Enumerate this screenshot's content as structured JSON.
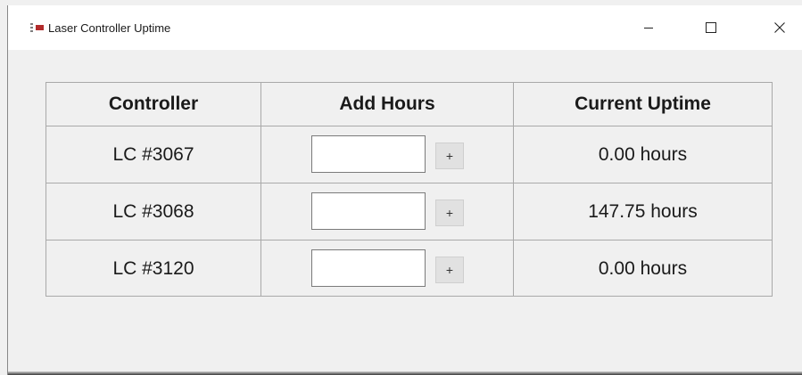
{
  "window": {
    "title": "Laser Controller Uptime",
    "buttons": {
      "minimize_icon": "minimize-icon",
      "maximize_icon": "maximize-icon",
      "close_icon": "close-icon"
    }
  },
  "table": {
    "headers": {
      "controller": "Controller",
      "add_hours": "Add Hours",
      "current_uptime": "Current Uptime"
    },
    "rows": [
      {
        "controller": "LC #3067",
        "add_hours_value": "",
        "add_label": "+",
        "uptime": "0.00 hours"
      },
      {
        "controller": "LC #3068",
        "add_hours_value": "",
        "add_label": "+",
        "uptime": "147.75 hours"
      },
      {
        "controller": "LC #3120",
        "add_hours_value": "",
        "add_label": "+",
        "uptime": "0.00 hours"
      }
    ]
  }
}
